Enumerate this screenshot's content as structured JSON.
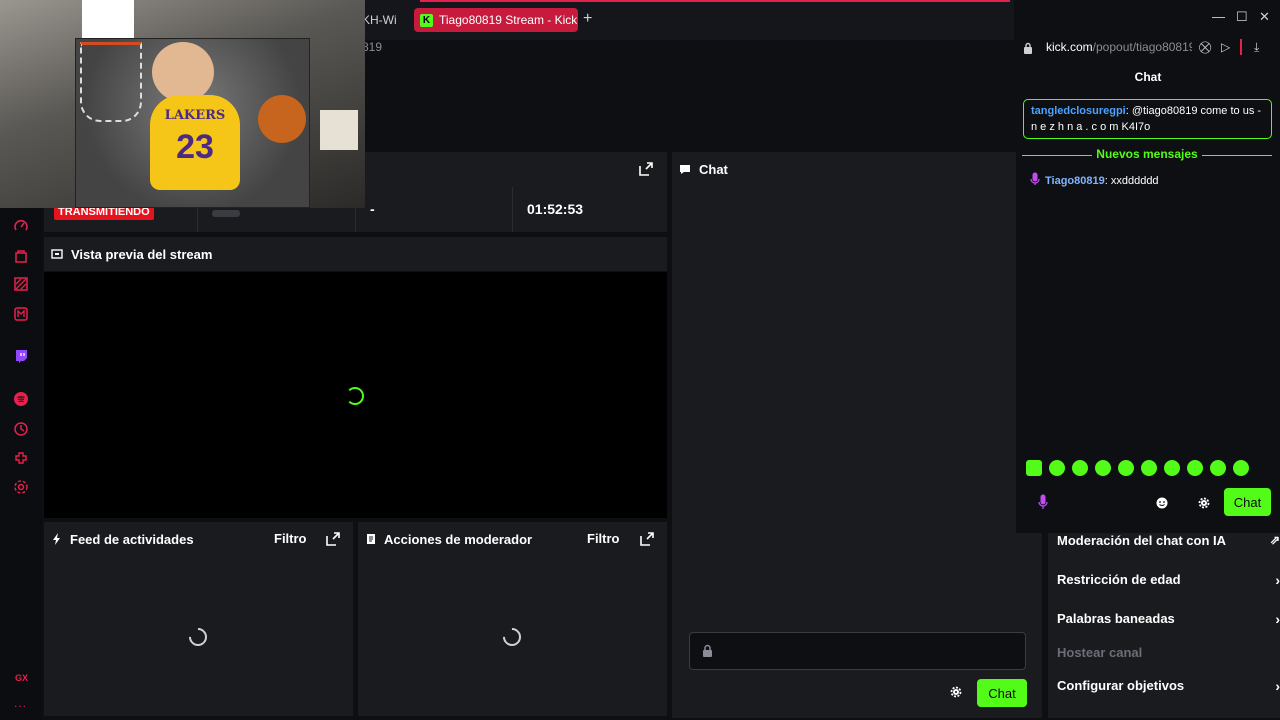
{
  "browser": {
    "partial_tab_label": "KH-Wi",
    "active_tab_label": "Tiago80819 Stream - Kick",
    "address_partial": "819"
  },
  "stats": {
    "live_badge": "TRANSMITIENDO",
    "viewers_value": "-",
    "uptime": "01:52:53"
  },
  "preview": {
    "title": "Vista previa del stream"
  },
  "feed": {
    "title": "Feed de actividades",
    "filter_label": "Filtro"
  },
  "mod_actions": {
    "title": "Acciones de moderador",
    "filter_label": "Filtro"
  },
  "chat_column": {
    "title": "Chat",
    "send_label": "Chat"
  },
  "mod_menu": {
    "items": [
      {
        "label": "Moderación del chat con IA"
      },
      {
        "label": "Restricción de edad"
      },
      {
        "label": "Palabras baneadas"
      },
      {
        "label": "Hostear canal"
      },
      {
        "label": "Configurar objetivos"
      }
    ]
  },
  "popout": {
    "url_host": "kick.com",
    "url_path": "/popout/tiago80819",
    "title": "Chat",
    "pinned": {
      "user": "tangledclosuregpi",
      "text": ": @tiago80819 come to us - n e z h n a . c o m K4I7o"
    },
    "new_messages_label": "Nuevos mensajes",
    "message": {
      "user": "Tiago80819",
      "text": ": xxdddddd"
    },
    "send_label": "Chat"
  },
  "webcam": {
    "jersey_text": "LAKERS",
    "jersey_number": "23"
  },
  "sidebar": {
    "gx_label": "GX",
    "more_label": "..."
  },
  "colors": {
    "accent_green": "#53fc18",
    "live_red": "#e5131d",
    "opera_red": "#e5224d",
    "panel_bg": "#191b1f"
  }
}
